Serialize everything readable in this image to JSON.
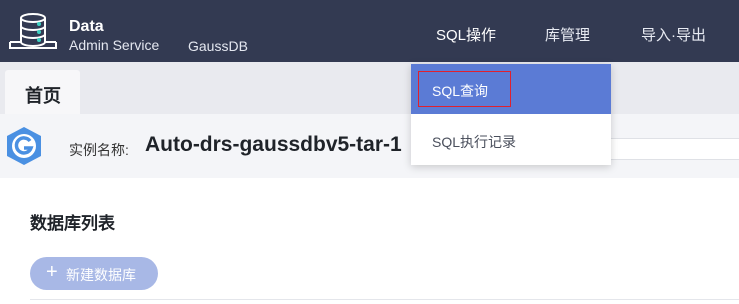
{
  "header": {
    "brand_line1": "Data",
    "brand_line2": "Admin Service",
    "product": "GaussDB",
    "nav": [
      {
        "label": "SQL操作"
      },
      {
        "label": "库管理"
      },
      {
        "label": "导入·导出"
      }
    ]
  },
  "tabs": {
    "home": "首页"
  },
  "instance": {
    "label": "实例名称:",
    "name": "Auto-drs-gaussdbv5-tar-1"
  },
  "main": {
    "section_title": "数据库列表",
    "new_db_plus": "+",
    "new_db_label": "新建数据库"
  },
  "dropdown": {
    "items": [
      {
        "label": "SQL查询"
      },
      {
        "label": "SQL执行记录"
      }
    ]
  },
  "colors": {
    "topbar": "#333a52",
    "accent": "#5b7bd5",
    "highlight": "#e0202e"
  }
}
